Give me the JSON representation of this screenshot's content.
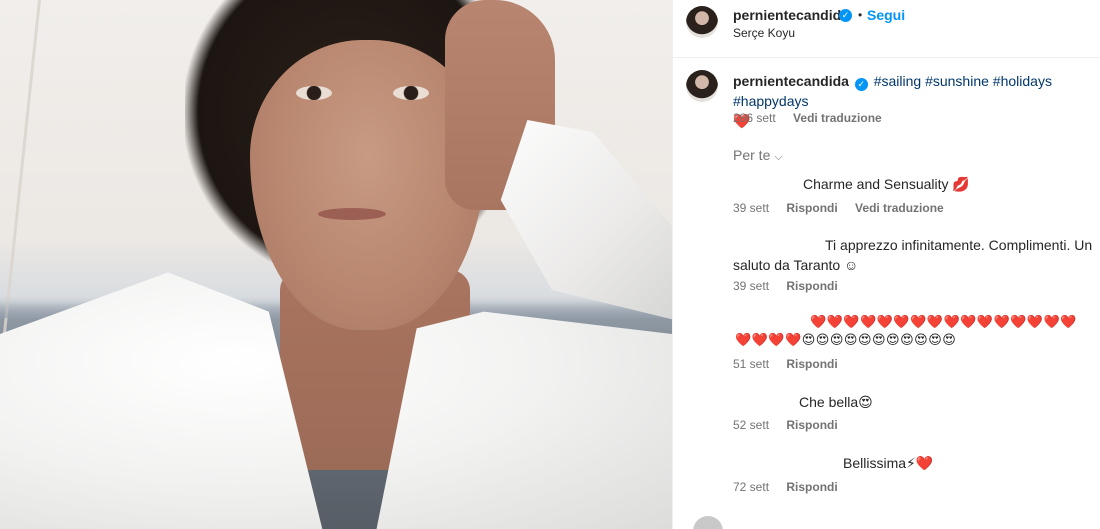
{
  "post": {
    "username": "pernientecandida",
    "follow_label": "Segui",
    "separator": "•",
    "location": "Serçe Koyu",
    "verified_mark": "✓"
  },
  "caption": {
    "username": "pernientecandida",
    "hashtags": [
      "#sailing",
      "#sunshine",
      "#holidays",
      "#happydays"
    ],
    "trailing_emoji": "❤️",
    "time": "286 sett",
    "translate_label": "Vedi traduzione"
  },
  "filter": {
    "label": "Per te",
    "chevron": "⌵"
  },
  "comments": [
    {
      "text": "Charme and Sensuality 💋",
      "time": "39 sett",
      "reply_label": "Rispondi",
      "translate_label": "Vedi traduzione"
    },
    {
      "text_line1": "Ti apprezzo infinitamente. Complimenti. Un",
      "text_line2": "saluto da Taranto ☺",
      "time": "39 sett",
      "reply_label": "Rispondi"
    },
    {
      "line1": "❤️❤️❤️❤️❤️❤️❤️❤️❤️❤️❤️❤️❤️❤️❤️❤️",
      "line2": "❤️❤️❤️❤️😍😍😍😍😍😍😍😍😍😍😍",
      "time": "51 sett",
      "reply_label": "Rispondi"
    },
    {
      "text": "Che bella😍",
      "time": "52 sett",
      "reply_label": "Rispondi"
    },
    {
      "text": "Bellissima⚡❤️",
      "time": "72 sett",
      "reply_label": "Rispondi"
    }
  ],
  "icons": {
    "avatar": "avatar",
    "verified": "verified-badge-icon",
    "chevron": "chevron-down-icon"
  },
  "colors": {
    "link_blue": "#0095f6",
    "hashtag": "#00376b",
    "muted": "#737373",
    "heart": "#ed4956"
  }
}
